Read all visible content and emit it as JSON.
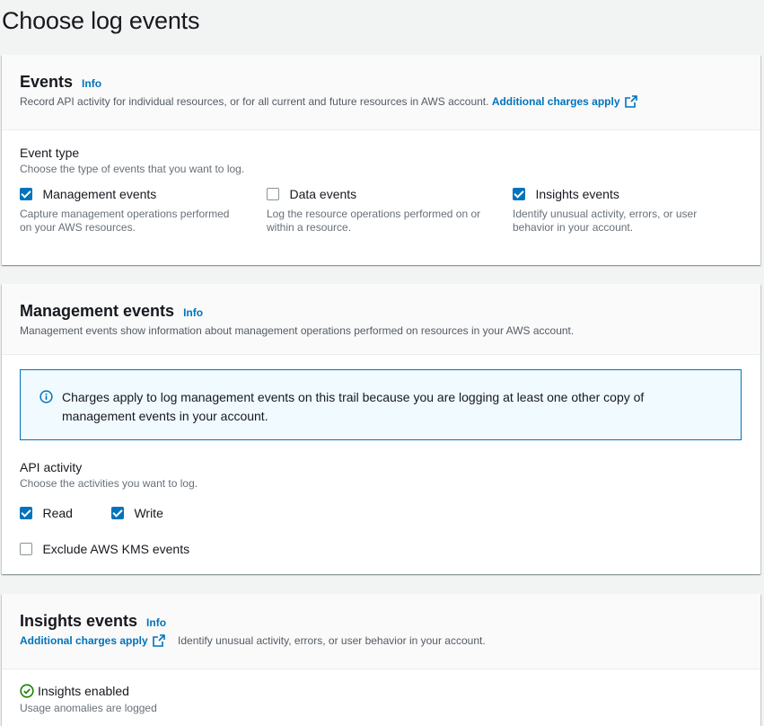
{
  "page": {
    "title": "Choose log events"
  },
  "events_panel": {
    "title": "Events",
    "info": "Info",
    "description": "Record API activity for individual resources, or for all current and future resources in AWS account.",
    "charges_link": "Additional charges apply",
    "event_type": {
      "label": "Event type",
      "description": "Choose the type of events that you want to log.",
      "options": [
        {
          "label": "Management events",
          "checked": true,
          "description_line1": "Capture management operations performed",
          "description_line2": "on your AWS resources."
        },
        {
          "label": "Data events",
          "checked": false,
          "description_line1": "Log the resource operations performed on or",
          "description_line2": "within a resource."
        },
        {
          "label": "Insights events",
          "checked": true,
          "description_line1": "Identify unusual activity, errors, or user",
          "description_line2": "behavior in your account."
        }
      ]
    }
  },
  "management_panel": {
    "title": "Management events",
    "info": "Info",
    "description": "Management events show information about management operations performed on resources in your AWS account.",
    "alert": {
      "line1": "Charges apply to log management events on this trail because you are logging at least one other copy of",
      "line2": "management events in your account."
    },
    "api_activity": {
      "label": "API activity",
      "description": "Choose the activities you want to log.",
      "read": {
        "label": "Read",
        "checked": true
      },
      "write": {
        "label": "Write",
        "checked": true
      },
      "exclude_kms": {
        "label": "Exclude AWS KMS events",
        "checked": false
      }
    }
  },
  "insights_panel": {
    "title": "Insights events",
    "info": "Info",
    "charges_link": "Additional charges apply",
    "description": "Identify unusual activity, errors, or user behavior in your account.",
    "status": {
      "label": "Insights enabled",
      "description": "Usage anomalies are logged"
    }
  },
  "colors": {
    "link": "#0073bb",
    "checkbox": "#0073bb",
    "success": "#1d8102",
    "alert_bg": "#f1faff"
  },
  "icons": [
    "external-link-icon",
    "info-circle-icon",
    "check-circle-icon"
  ]
}
